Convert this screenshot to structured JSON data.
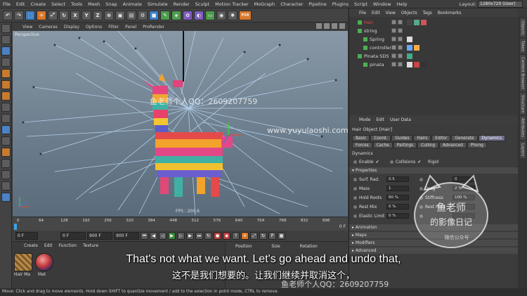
{
  "menubar": {
    "items": [
      "File",
      "Edit",
      "Create",
      "Select",
      "Tools",
      "Mesh",
      "Snap",
      "Animate",
      "Simulate",
      "Render",
      "Sculpt",
      "Motion Tracker",
      "MoGraph",
      "Character",
      "Pipeline",
      "Plugins",
      "Script",
      "Window",
      "Help"
    ],
    "layout_label": "Layout:",
    "layout_value": "1280x720 (User)"
  },
  "toolbar": {
    "buttons": [
      "X",
      "Y",
      "Z"
    ],
    "psr_label": "PSR"
  },
  "viewport": {
    "menu": [
      "View",
      "Cameras",
      "Display",
      "Options",
      "Filter",
      "Panel",
      "ProRender"
    ],
    "label": "Perspective",
    "fps": "FPS : 200.6",
    "watermark_name": "鱼老师个人QQ：2609207759",
    "watermark_url": "www.yuyulaoshi.com"
  },
  "timeline": {
    "ticks": [
      "0",
      "64",
      "128",
      "192",
      "256",
      "320",
      "384",
      "448",
      "512",
      "576",
      "640",
      "704",
      "768",
      "832",
      "896"
    ],
    "end_label": "0 F"
  },
  "transport": {
    "current_frame": "0 F",
    "start_frame": "0 F",
    "end_frame": "900 F",
    "end_frame2": "900 F"
  },
  "materials": {
    "menu": [
      "Create",
      "Edit",
      "Function",
      "Texture"
    ],
    "items": [
      {
        "name": "Hair Ma",
        "color": "#b88a4a"
      },
      {
        "name": "Mat",
        "color": "#c23a3a"
      }
    ]
  },
  "coords": {
    "headers": [
      "Position",
      "Size",
      "Rotation"
    ]
  },
  "objects": {
    "menu": [
      "File",
      "Edit",
      "View",
      "Objects",
      "Tags",
      "Bookmarks"
    ],
    "rows": [
      {
        "name": "Hair",
        "color": "#e04a4a",
        "indent": 0
      },
      {
        "name": "string",
        "color": "#d8d8d8",
        "indent": 0
      },
      {
        "name": "Spring",
        "color": "#d8d8d8",
        "indent": 8
      },
      {
        "name": "controller",
        "color": "#d8d8d8",
        "indent": 8
      },
      {
        "name": "Pinata SDS",
        "color": "#d8d8d8",
        "indent": 0
      },
      {
        "name": "pinata",
        "color": "#d8d8d8",
        "indent": 8
      }
    ]
  },
  "attributes": {
    "menu": [
      "Mode",
      "Edit",
      "User Data"
    ],
    "title": "Hair Object [Hair]",
    "tabs_row1": [
      "Basic",
      "Coord.",
      "Guides",
      "Hairs",
      "Editor",
      "Generate",
      "Dynamics"
    ],
    "tabs_row2": [
      "Forces",
      "Cache",
      "Partings",
      "Culling",
      "Advanced",
      "Phong"
    ],
    "active_tab": "Dynamics",
    "section_title": "Dynamics",
    "enable_label": "Enable",
    "collisions_label": "Collisions",
    "rigid_label": "Rigid",
    "properties_header": "Properties",
    "props_left": [
      {
        "label": "Surf. Rad.",
        "value": "0.5"
      },
      {
        "label": "Mass",
        "value": "1"
      },
      {
        "label": "Hold Roots",
        "value": "80 %"
      },
      {
        "label": "Rest Mix",
        "value": "0 %"
      },
      {
        "label": "Elastic Limit",
        "value": "0 %"
      }
    ],
    "props_right": [
      {
        "label": "",
        "value": "0"
      },
      {
        "label": "Drag",
        "value": "2 %"
      },
      {
        "label": "Stiffness",
        "value": "100 %"
      },
      {
        "label": "Rest Hold",
        "value": ""
      },
      {
        "label": "",
        "value": ""
      }
    ],
    "sections": [
      "Animation",
      "Maps",
      "Modifiers",
      "Advanced"
    ]
  },
  "side_tabs": [
    "Objects",
    "Takes",
    "Content Browser",
    "Structure",
    "Attributes",
    "Layers"
  ],
  "statusbar": "Move: Click and drag to move elements. Hold down SHIFT to quantize movement / add to the selection in point mode, CTRL to remove.",
  "subtitles": {
    "en": "That's not what we want. Let's go ahead and undo that,",
    "cn": "这不是我们想要的。让我们继续并取消这个，",
    "qq_watermark": "鱼老师个人QQ：2609207759"
  },
  "stamp": {
    "top": "鱼老师",
    "bottom": "的影像日记",
    "small": "微信公众号"
  }
}
